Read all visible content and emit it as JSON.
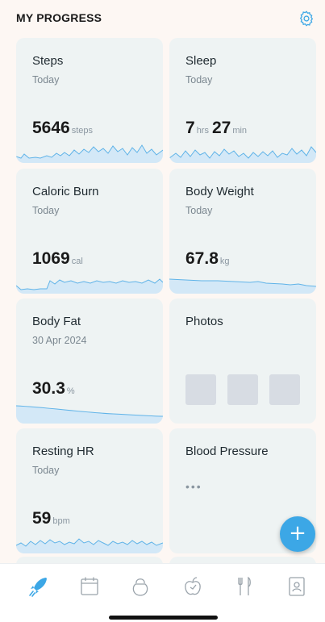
{
  "header": {
    "title": "MY PROGRESS"
  },
  "cards": {
    "steps": {
      "title": "Steps",
      "subtitle": "Today",
      "value": "5646",
      "unit": "steps"
    },
    "sleep": {
      "title": "Sleep",
      "subtitle": "Today",
      "hours": "7",
      "hours_unit": "hrs",
      "minutes": "27",
      "minutes_unit": "min"
    },
    "calories": {
      "title": "Caloric Burn",
      "subtitle": "Today",
      "value": "1069",
      "unit": "cal"
    },
    "weight": {
      "title": "Body Weight",
      "subtitle": "Today",
      "value": "67.8",
      "unit": "kg"
    },
    "body_fat": {
      "title": "Body Fat",
      "subtitle": "30 Apr 2024",
      "value": "30.3",
      "unit": "%"
    },
    "photos": {
      "title": "Photos"
    },
    "resting_hr": {
      "title": "Resting HR",
      "subtitle": "Today",
      "value": "59",
      "unit": "bpm"
    },
    "blood_pressure": {
      "title": "Blood Pressure",
      "placeholder": "•••"
    }
  },
  "fab": {
    "label": "+"
  },
  "tabbar": {
    "items": [
      {
        "icon": "rocket-icon",
        "active": true
      },
      {
        "icon": "calendar-icon",
        "active": false
      },
      {
        "icon": "kettlebell-icon",
        "active": false
      },
      {
        "icon": "apple-icon",
        "active": false
      },
      {
        "icon": "fork-knife-icon",
        "active": false
      },
      {
        "icon": "contact-card-icon",
        "active": false
      }
    ]
  },
  "colors": {
    "accent": "#3ca7e6",
    "card_bg": "#eef3f3",
    "spark_line": "#5fb3e8",
    "spark_fill": "#d3e8f7"
  }
}
